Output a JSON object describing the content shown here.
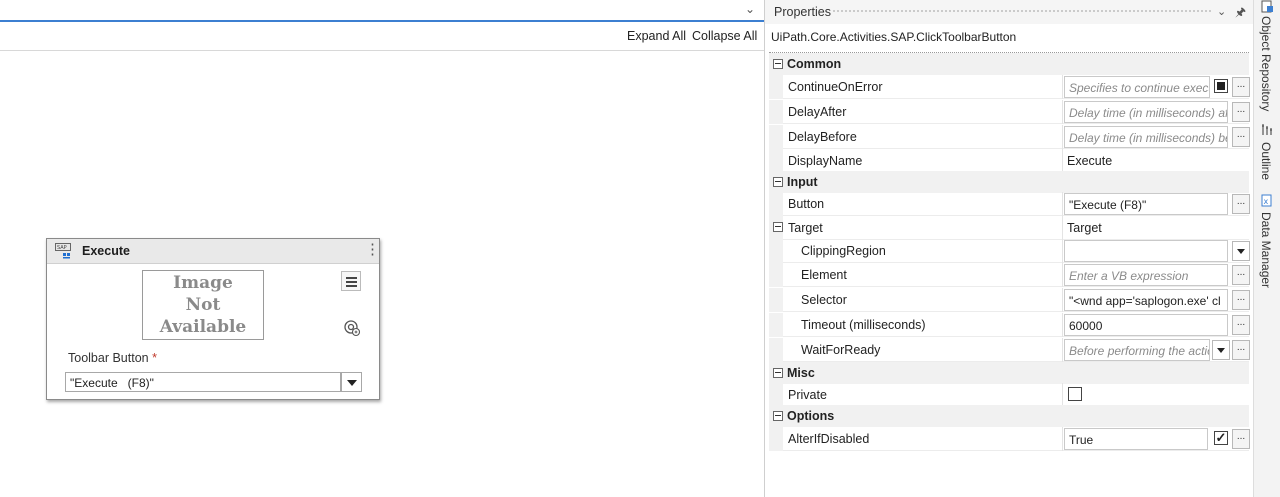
{
  "designer": {
    "expand_all": "Expand All",
    "collapse_all": "Collapse All"
  },
  "activity": {
    "title": "Execute",
    "image_placeholder": [
      "Image",
      "Not",
      "Available"
    ],
    "field_label": "Toolbar Button",
    "required_mark": "*",
    "field_value": "\"Execute   (F8)\""
  },
  "properties": {
    "title": "Properties",
    "class_name": "UiPath.Core.Activities.SAP.ClickToolbarButton",
    "ellipsis": "...",
    "categories": {
      "common": "Common",
      "input": "Input",
      "misc": "Misc",
      "options": "Options"
    },
    "rows": {
      "continue_on_error": {
        "name": "ContinueOnError",
        "value": "Specifies to continue executing"
      },
      "delay_after": {
        "name": "DelayAfter",
        "value": "Delay time (in milliseconds) after"
      },
      "delay_before": {
        "name": "DelayBefore",
        "value": "Delay time (in milliseconds) before"
      },
      "display_name": {
        "name": "DisplayName",
        "value": "Execute"
      },
      "button": {
        "name": "Button",
        "value": "\"Execute   (F8)\""
      },
      "target": {
        "name": "Target",
        "value": "Target"
      },
      "clipping_region": {
        "name": "ClippingRegion",
        "value": ""
      },
      "element": {
        "name": "Element",
        "value": "Enter a VB expression"
      },
      "selector": {
        "name": "Selector",
        "value": "\"<wnd app='saplogon.exe' cl"
      },
      "timeout": {
        "name": "Timeout (milliseconds)",
        "value": "60000"
      },
      "wait_for_ready": {
        "name": "WaitForReady",
        "value": "Before performing the action"
      },
      "private": {
        "name": "Private",
        "checked": false
      },
      "alter_if_disabled": {
        "name": "AlterIfDisabled",
        "value": "True",
        "checked": true
      }
    }
  },
  "side_tabs": {
    "object_repository": "Object Repository",
    "outline": "Outline",
    "data_manager": "Data Manager"
  },
  "colors": {
    "accent": "#3c7fd1",
    "required": "#c0392b",
    "placeholder_text": "#8a8a8a"
  }
}
